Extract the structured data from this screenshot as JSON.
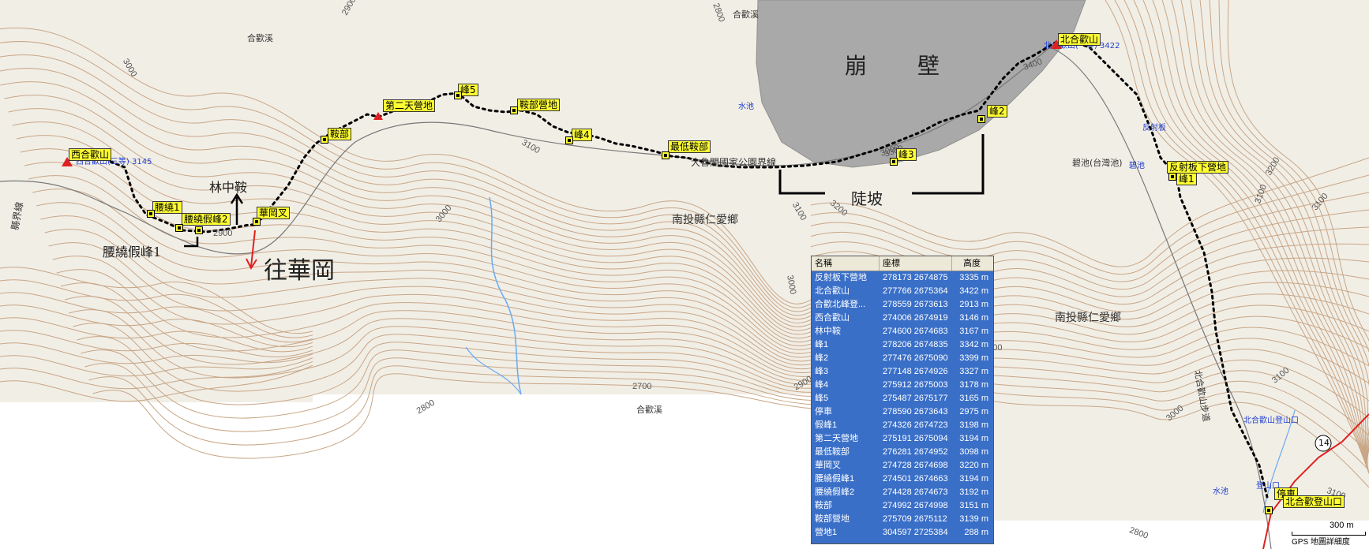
{
  "map": {
    "cliff_label": "崩　壁",
    "slope_label": "陡坡",
    "toward_label": "往華岡",
    "lin_zhong_label": "林中鞍",
    "bypass_label": "腰繞假峰1",
    "border_label": "大魯閣國家公園界線",
    "township_labels": [
      "南投縣仁愛鄉",
      "南投縣仁愛鄉"
    ],
    "creek_labels": [
      "合歡溪",
      "合歡溪",
      "合歡溪"
    ],
    "water_labels": [
      "水池",
      "水池"
    ],
    "pond_label": "碧池(台灣池)",
    "pond_sub": "碧池",
    "reflector_label": "反射板",
    "trail_label": "北合歡山步道",
    "trailhead_blue": "北合歡山登山口",
    "trailhead_small": "登山口",
    "west_peak_blue": "西合歡山(三等) 3145",
    "north_peak_blue": "北合歡山(一等) 3422",
    "county_line_label": "縣界線",
    "route_num": "14",
    "contours": [
      "3000",
      "2800",
      "2900",
      "2800",
      "3100",
      "3000",
      "3100",
      "3200",
      "3300",
      "3400",
      "3000",
      "2900",
      "2700",
      "2800",
      "3200",
      "3100",
      "3000",
      "2900",
      "3100",
      "3000",
      "3100",
      "2900",
      "3100"
    ]
  },
  "waypoints": {
    "west_peak": "西合歡山",
    "north_peak": "北合歡山",
    "bypass1": "腰繞1",
    "bypass_pair": "腰繞假峰2",
    "hua_gang": "華岡叉",
    "an_bu": "鞍部",
    "second_camp": "第二天營地",
    "peak5": "峰5",
    "anbu_camp": "鞍部營地",
    "peak4": "峰4",
    "lowest": "最低鞍部",
    "peak3": "峰3",
    "peak2": "峰2",
    "reflector_camp": "反射板下營地",
    "peak1": "峰1",
    "parking": "停車",
    "trailhead": "北合歡登山口"
  },
  "table": {
    "headers": [
      "名稱",
      "座標",
      "高度"
    ],
    "rows": [
      [
        "反射板下營地",
        "278173 2674875",
        "3335 m"
      ],
      [
        "北合歡山",
        "277766 2675364",
        "3422 m"
      ],
      [
        "合歡北峰登...",
        "278559 2673613",
        "2913 m"
      ],
      [
        "西合歡山",
        "274006 2674919",
        "3146 m"
      ],
      [
        "林中鞍",
        "274600 2674683",
        "3167 m"
      ],
      [
        "峰1",
        "278206 2674835",
        "3342 m"
      ],
      [
        "峰2",
        "277476 2675090",
        "3399 m"
      ],
      [
        "峰3",
        "277148 2674926",
        "3327 m"
      ],
      [
        "峰4",
        "275912 2675003",
        "3178 m"
      ],
      [
        "峰5",
        "275487 2675177",
        "3165 m"
      ],
      [
        "停車",
        "278590 2673643",
        "2975 m"
      ],
      [
        "假峰1",
        "274326 2674723",
        "3198 m"
      ],
      [
        "第二天營地",
        "275191 2675094",
        "3194 m"
      ],
      [
        "最低鞍部",
        "276281 2674952",
        "3098 m"
      ],
      [
        "華岡叉",
        "274728 2674698",
        "3220 m"
      ],
      [
        "腰繞假峰1",
        "274501 2674663",
        "3194 m"
      ],
      [
        "腰繞假峰2",
        "274428 2674673",
        "3192 m"
      ],
      [
        "鞍部",
        "274992 2674998",
        "3151 m"
      ],
      [
        "鞍部營地",
        "275709 2675112",
        "3139 m"
      ],
      [
        "營地1",
        "304597 2725384",
        "288 m"
      ]
    ]
  },
  "scale": {
    "distance": "300 m",
    "caption": "GPS 地圖詳細度"
  },
  "colors": {
    "terrain": "#f0ede4",
    "contour": "#c9a98a",
    "cliff": "#a8a8a8",
    "table_bg": "#3a6fc8",
    "waypoint": "#ffff33"
  }
}
